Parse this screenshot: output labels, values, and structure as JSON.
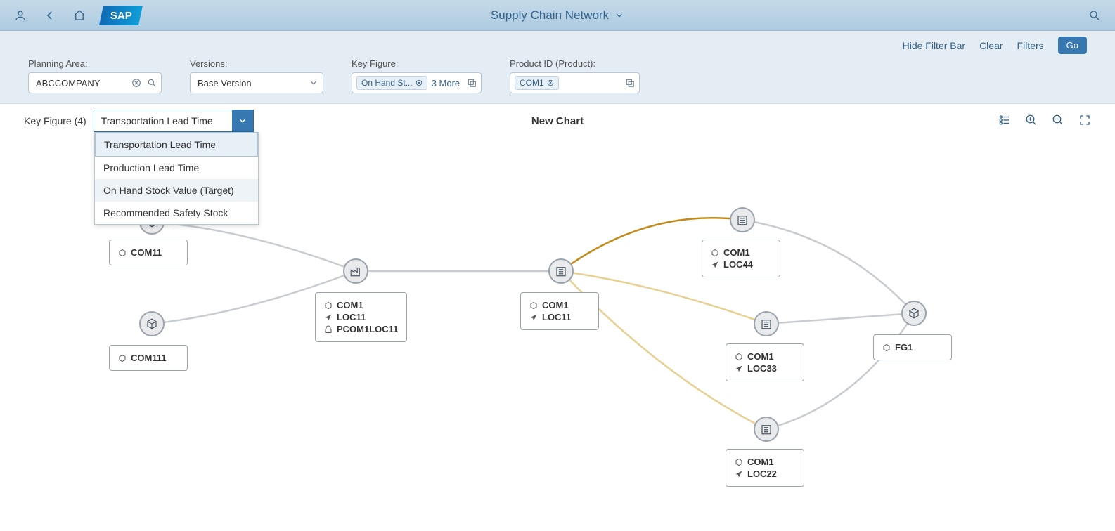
{
  "header": {
    "title": "Supply Chain Network"
  },
  "actions": {
    "hideFilter": "Hide Filter Bar",
    "clear": "Clear",
    "filters": "Filters",
    "go": "Go"
  },
  "filters": {
    "planningArea": {
      "label": "Planning Area:",
      "value": "ABCCOMPANY"
    },
    "versions": {
      "label": "Versions:",
      "value": "Base Version"
    },
    "keyFigure": {
      "label": "Key Figure:",
      "chip": "On Hand St...",
      "more": "3 More"
    },
    "productId": {
      "label": "Product ID (Product):",
      "chip": "COM1"
    }
  },
  "section": {
    "kfLabel": "Key Figure (4)",
    "selected": "Transportation Lead Time",
    "centerTitle": "New Chart",
    "options": [
      "Transportation Lead Time",
      "Production Lead Time",
      "On Hand Stock Value (Target)",
      "Recommended Safety Stock"
    ]
  },
  "nodes": {
    "n1": {
      "product": "COM11"
    },
    "n2": {
      "product": "COM111"
    },
    "n3": {
      "product": "COM1",
      "loc": "LOC11",
      "p": "PCOM1LOC11"
    },
    "n4": {
      "product": "COM1",
      "loc": "LOC11"
    },
    "n5": {
      "product": "COM1",
      "loc": "LOC44"
    },
    "n6": {
      "product": "COM1",
      "loc": "LOC33"
    },
    "n7": {
      "product": "COM1",
      "loc": "LOC22"
    },
    "n8": {
      "product": "FG1"
    }
  }
}
